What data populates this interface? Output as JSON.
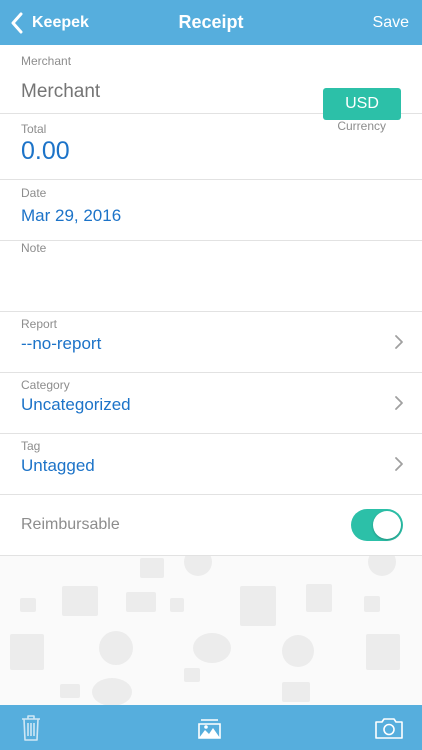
{
  "nav": {
    "back_label": "Keepek",
    "title": "Receipt",
    "save_label": "Save"
  },
  "merchant": {
    "label": "Merchant",
    "placeholder": "Merchant",
    "value": ""
  },
  "total": {
    "label": "Total",
    "value": "0.00"
  },
  "currency": {
    "label": "Currency",
    "value": "USD"
  },
  "date": {
    "label": "Date",
    "value": "Mar 29, 2016"
  },
  "note": {
    "label": "Note",
    "value": ""
  },
  "report": {
    "label": "Report",
    "value": "--no-report"
  },
  "category": {
    "label": "Category",
    "value": "Uncategorized"
  },
  "tag": {
    "label": "Tag",
    "value": "Untagged"
  },
  "reimbursable": {
    "label": "Reimbursable",
    "enabled": true
  },
  "toolbar": {
    "icons": [
      "trash-icon",
      "photo-library-icon",
      "camera-icon"
    ]
  },
  "colors": {
    "nav": "#56aedd",
    "accent": "#2cc0a8",
    "value_text": "#1c73c8",
    "label_text": "#8d8d8d"
  }
}
